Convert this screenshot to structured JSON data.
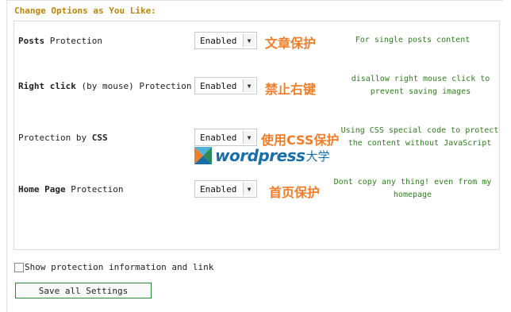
{
  "header": {
    "title": "Change Options as You Like:"
  },
  "rows": [
    {
      "label_bold": "Posts",
      "label_rest": " Protection",
      "value": "Enabled",
      "annotation": "文章保护",
      "description": [
        "For single posts content"
      ]
    },
    {
      "label_bold": "Right click",
      "label_rest": " (by mouse) Protection",
      "value": "Enabled",
      "annotation": "禁止右键",
      "description": [
        "disallow right mouse click to",
        "prevent saving images"
      ]
    },
    {
      "label_pre": "Protection by ",
      "label_bold": "CSS",
      "value": "Enabled",
      "annotation": "使用CSS保护",
      "description": [
        "Using CSS special code to protect",
        "the content without JavaScript"
      ]
    },
    {
      "label_bold": "Home Page",
      "label_rest": " Protection",
      "value": "Enabled",
      "annotation": "首页保护",
      "description": [
        "Dont copy any thing! even from my",
        "homepage"
      ]
    }
  ],
  "watermark": {
    "text": "wordpress",
    "text_cn": "大学"
  },
  "checkbox": {
    "label": "Show protection information and link",
    "checked": false
  },
  "save_button": {
    "label": "Save all Settings"
  },
  "colors": {
    "title": "#b8860b",
    "annotation": "#f07d2a",
    "description": "#2e7d1e",
    "button_border": "#2a8a3a"
  }
}
